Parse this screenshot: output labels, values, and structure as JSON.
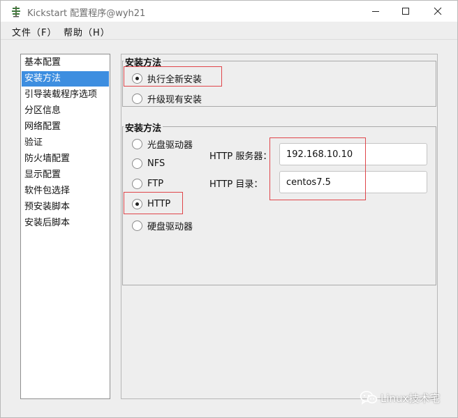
{
  "window": {
    "title": "Kickstart 配置程序@wyh21",
    "app_icon": "kickstart-tree-icon",
    "controls": [
      "minimize-icon",
      "maximize-icon",
      "close-icon"
    ]
  },
  "menu": {
    "file": "文件（F）",
    "help": "帮助（H）"
  },
  "sidebar": {
    "items": [
      {
        "label": "基本配置",
        "selected": false
      },
      {
        "label": "安装方法",
        "selected": true
      },
      {
        "label": "引导装载程序选项",
        "selected": false
      },
      {
        "label": "分区信息",
        "selected": false
      },
      {
        "label": "网络配置",
        "selected": false
      },
      {
        "label": "验证",
        "selected": false
      },
      {
        "label": "防火墙配置",
        "selected": false
      },
      {
        "label": "显示配置",
        "selected": false
      },
      {
        "label": "软件包选择",
        "selected": false
      },
      {
        "label": "预安装脚本",
        "selected": false
      },
      {
        "label": "安装后脚本",
        "selected": false
      }
    ]
  },
  "install_type": {
    "title": "安装方法",
    "options": [
      {
        "label": "执行全新安装",
        "checked": true
      },
      {
        "label": "升级现有安装",
        "checked": false
      }
    ]
  },
  "install_source": {
    "title": "安装方法",
    "options": [
      {
        "label": "光盘驱动器",
        "checked": false
      },
      {
        "label": "NFS",
        "checked": false
      },
      {
        "label": "FTP",
        "checked": false
      },
      {
        "label": "HTTP",
        "checked": true
      },
      {
        "label": "硬盘驱动器",
        "checked": false
      }
    ],
    "http_server_label": "HTTP 服务器：",
    "http_server_value": "192.168.10.10",
    "http_dir_label": "HTTP 目录：",
    "http_dir_value": "centos7.5"
  },
  "highlight_color": "#e0454a",
  "selection_color": "#3d8ee0",
  "watermark": {
    "icon": "wechat-icon",
    "text": "Linux技术宅"
  }
}
